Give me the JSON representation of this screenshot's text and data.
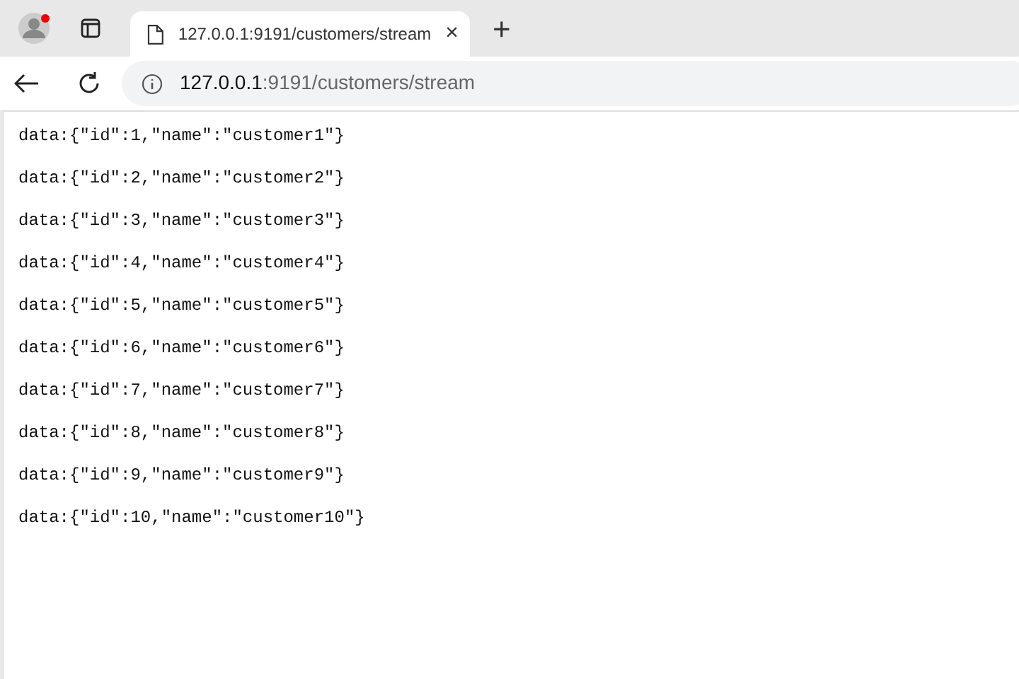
{
  "tab": {
    "title": "127.0.0.1:9191/customers/stream",
    "close": "×",
    "selected": true
  },
  "new_tab": "+",
  "address_bar": {
    "host": "127.0.0.1",
    "path": ":9191/customers/stream"
  },
  "profile": {
    "notification": true
  },
  "lines": [
    "data:{\"id\":1,\"name\":\"customer1\"}",
    "data:{\"id\":2,\"name\":\"customer2\"}",
    "data:{\"id\":3,\"name\":\"customer3\"}",
    "data:{\"id\":4,\"name\":\"customer4\"}",
    "data:{\"id\":5,\"name\":\"customer5\"}",
    "data:{\"id\":6,\"name\":\"customer6\"}",
    "data:{\"id\":7,\"name\":\"customer7\"}",
    "data:{\"id\":8,\"name\":\"customer8\"}",
    "data:{\"id\":9,\"name\":\"customer9\"}",
    "data:{\"id\":10,\"name\":\"customer10\"}"
  ]
}
